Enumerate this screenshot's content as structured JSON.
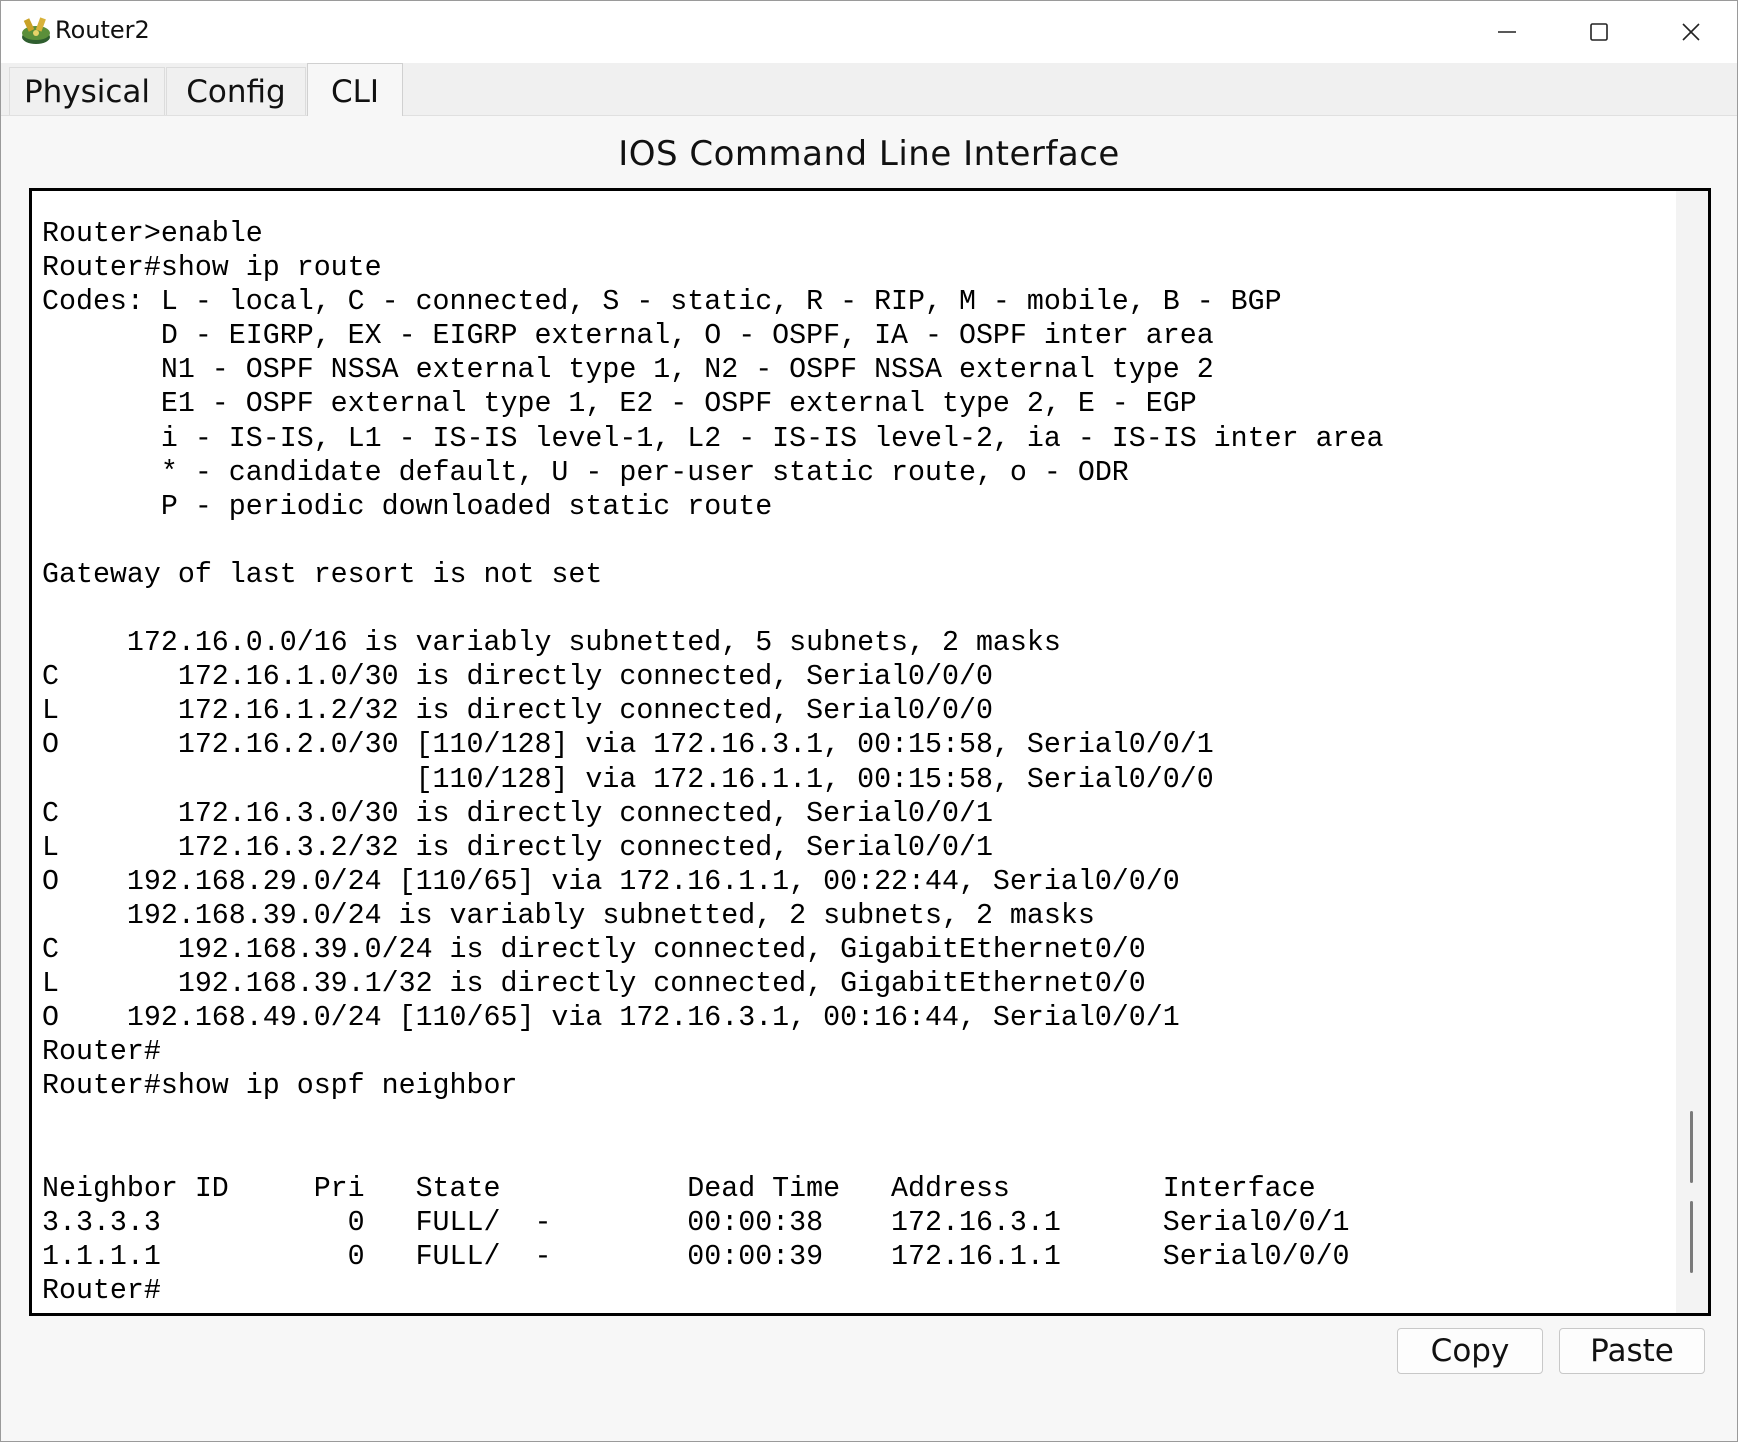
{
  "window": {
    "title": "Router2"
  },
  "tabs": [
    {
      "label": "Physical"
    },
    {
      "label": "Config"
    },
    {
      "label": "CLI"
    }
  ],
  "active_tab": "CLI",
  "heading": "IOS Command Line Interface",
  "terminal": {
    "lines": [
      "Router>enable",
      "Router#show ip route",
      "Codes: L - local, C - connected, S - static, R - RIP, M - mobile, B - BGP",
      "       D - EIGRP, EX - EIGRP external, O - OSPF, IA - OSPF inter area",
      "       N1 - OSPF NSSA external type 1, N2 - OSPF NSSA external type 2",
      "       E1 - OSPF external type 1, E2 - OSPF external type 2, E - EGP",
      "       i - IS-IS, L1 - IS-IS level-1, L2 - IS-IS level-2, ia - IS-IS inter area",
      "       * - candidate default, U - per-user static route, o - ODR",
      "       P - periodic downloaded static route",
      "",
      "Gateway of last resort is not set",
      "",
      "     172.16.0.0/16 is variably subnetted, 5 subnets, 2 masks",
      "C       172.16.1.0/30 is directly connected, Serial0/0/0",
      "L       172.16.1.2/32 is directly connected, Serial0/0/0",
      "O       172.16.2.0/30 [110/128] via 172.16.3.1, 00:15:58, Serial0/0/1",
      "                      [110/128] via 172.16.1.1, 00:15:58, Serial0/0/0",
      "C       172.16.3.0/30 is directly connected, Serial0/0/1",
      "L       172.16.3.2/32 is directly connected, Serial0/0/1",
      "O    192.168.29.0/24 [110/65] via 172.16.1.1, 00:22:44, Serial0/0/0",
      "     192.168.39.0/24 is variably subnetted, 2 subnets, 2 masks",
      "C       192.168.39.0/24 is directly connected, GigabitEthernet0/0",
      "L       192.168.39.1/32 is directly connected, GigabitEthernet0/0",
      "O    192.168.49.0/24 [110/65] via 172.16.3.1, 00:16:44, Serial0/0/1",
      "Router#",
      "Router#show ip ospf neighbor",
      "",
      "",
      "Neighbor ID     Pri   State           Dead Time   Address         Interface",
      "3.3.3.3           0   FULL/  -        00:00:38    172.16.3.1      Serial0/0/1",
      "1.1.1.1           0   FULL/  -        00:00:39    172.16.1.1      Serial0/0/0",
      "Router#"
    ]
  },
  "actions": {
    "copy_label": "Copy",
    "paste_label": "Paste"
  },
  "colors": {
    "terminal_bg": "#ffffff",
    "terminal_text": "#000000",
    "window_bg": "#f0f0f0"
  }
}
